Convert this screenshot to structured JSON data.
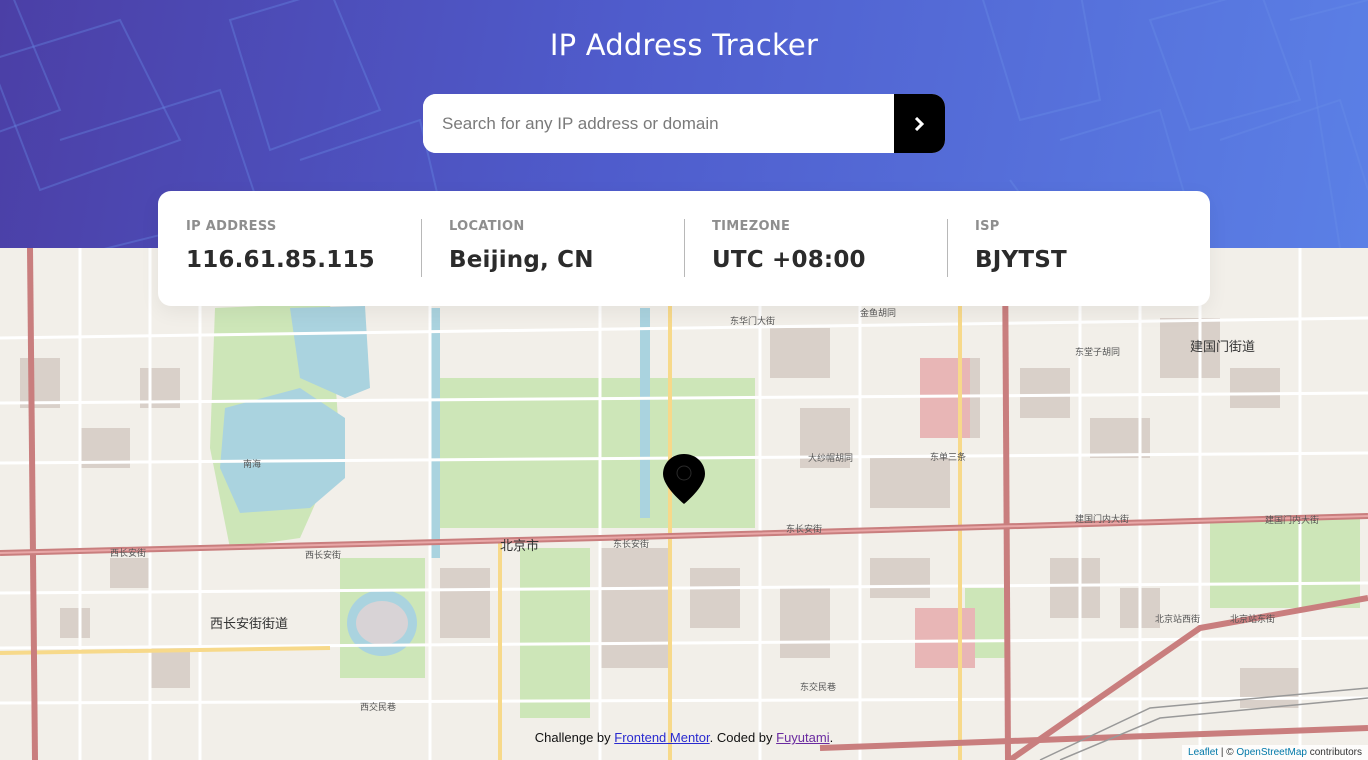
{
  "header": {
    "title": "IP Address Tracker",
    "search_placeholder": "Search for any IP address or domain",
    "submit_icon": "chevron-right-icon",
    "gradient_colors": [
      "#4b3fa6",
      "#5b80e6"
    ]
  },
  "info": {
    "ip_label": "IP ADDRESS",
    "ip_value": "116.61.85.115",
    "location_label": "LOCATION",
    "location_value": "Beijing, CN",
    "timezone_label": "TIMEZONE",
    "timezone_value": "UTC +08:00",
    "isp_label": "ISP",
    "isp_value": "BJYTST"
  },
  "map": {
    "marker_icon": "location-pin-icon",
    "labels": {
      "beijing": "北京市",
      "xichang_anjie": "西长安街",
      "xichang_anjie_2": "西长安街",
      "dongchang_anjie": "东长安街",
      "dongchang_anjie_2": "东长安街",
      "jianguomennei": "建国门内大街",
      "jianguomennei_2": "建国门内大街",
      "jianguomen": "建国门街道",
      "xichangan_district": "西长安街街道",
      "nanhai": "南海",
      "dongdan": "东单三条",
      "jinyu": "金鱼胡同",
      "dongbao": "东堂子胡同",
      "dongjiao": "东交民巷",
      "xijiao": "西交民巷",
      "beijingzhan": "北京站西街",
      "beijingzhan_dong": "北京站东街",
      "wangfujing": "东华门大街",
      "dadeng": "大纱帽胡同"
    }
  },
  "footer": {
    "prefix": "Challenge by ",
    "link1": "Frontend Mentor",
    "middle": ". Coded by ",
    "link2": "Fuyutami",
    "suffix": "."
  },
  "attribution": {
    "leaflet": "Leaflet",
    "sep": " | © ",
    "osm": "OpenStreetMap",
    "tail": " contributors"
  }
}
